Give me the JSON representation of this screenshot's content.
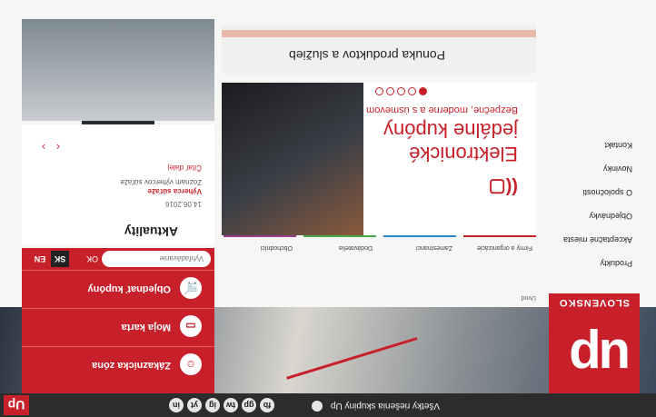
{
  "topbar": {
    "up_mini": "Up",
    "all_solutions": "Všetky riešenia skupiny Up",
    "social_icons": [
      "in",
      "yt",
      "ig",
      "tw",
      "gp",
      "fb"
    ]
  },
  "logo": {
    "mark": "up",
    "country": "SLOVENSKO"
  },
  "sidebar": {
    "items": [
      "Produkty",
      "Akceptačné miesta",
      "Objednávky",
      "O spoločnosti",
      "Novinky",
      "Kontakt"
    ]
  },
  "breadcrumb": "Úvod",
  "tabs": [
    {
      "label": "Firmy a organizácie",
      "color": "#c8202a"
    },
    {
      "label": "Zamestnanci",
      "color": "#2a86c8"
    },
    {
      "label": "Dodávatelia",
      "color": "#48a84a"
    },
    {
      "label": "Obchodníci",
      "color": "#9a3c8c"
    }
  ],
  "banner": {
    "title_line1": "Elektronické",
    "title_line2": "jedálne kupóny",
    "subtitle": "Bezpečne, moderne a s úsmevom",
    "nfc_icon": "contactless-icon",
    "slides_total": 5,
    "slide_active": 1
  },
  "offer": {
    "title": "Ponuka produktov a služieb"
  },
  "menu": {
    "items": [
      {
        "label": "Objednať kupóny",
        "icon": "cart-icon"
      },
      {
        "label": "Moja karta",
        "icon": "card-icon"
      },
      {
        "label": "Zákaznícka zóna",
        "icon": "user-icon"
      }
    ]
  },
  "login": {
    "placeholder": "Vyhľadávanie",
    "ok": "OK",
    "lang_sk": "SK",
    "lang_en": "EN"
  },
  "news": {
    "title": "Aktuality",
    "date": "14.06.2016",
    "line1": "Výherca súťaže",
    "line2": "Zoznam výhercov súťaže",
    "more": "Čítať ďalej"
  },
  "colors": {
    "brand": "#c8202a"
  }
}
